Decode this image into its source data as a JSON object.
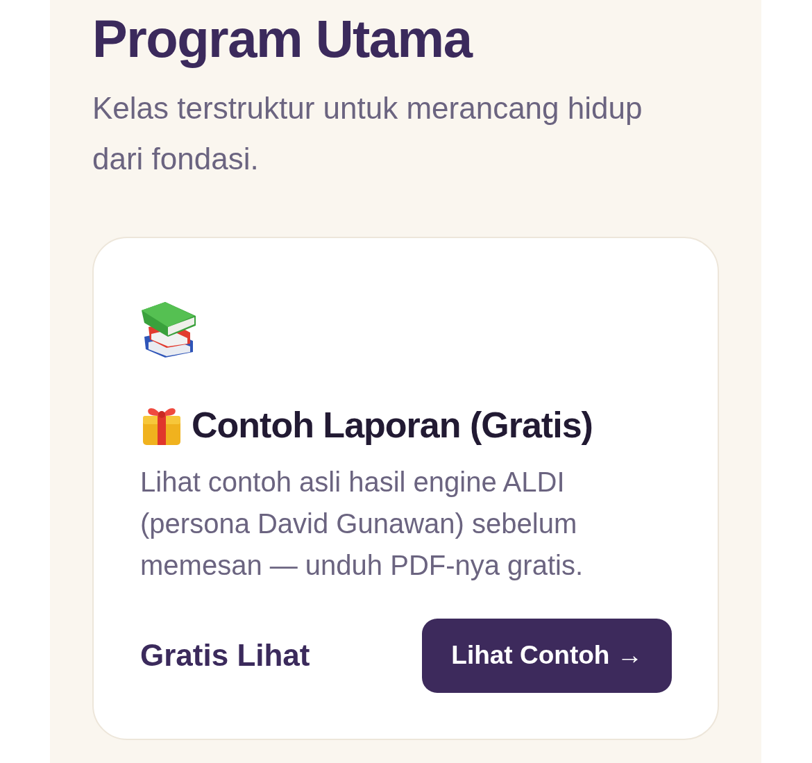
{
  "section": {
    "title": "Program Utama",
    "subtitle": "Kelas terstruktur untuk merancang hidup dari fondasi."
  },
  "cards": [
    {
      "title": "Contoh Laporan (Gratis)",
      "description": "Lihat contoh asli hasil engine ALDI (persona David Gunawan) sebelum memesan — unduh PDF-nya gratis.",
      "price_label": "Gratis Lihat",
      "button": {
        "label": "Lihat Contoh →"
      }
    }
  ]
}
